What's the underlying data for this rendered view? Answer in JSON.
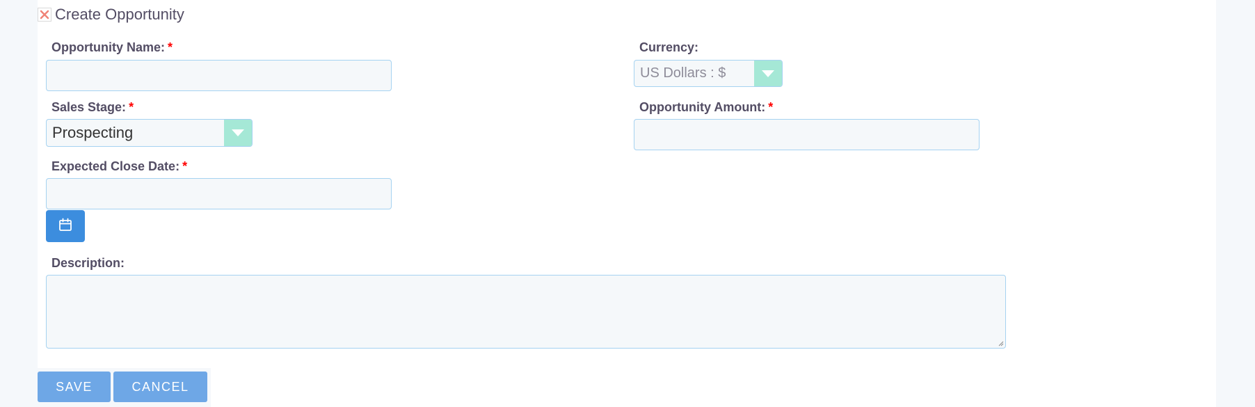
{
  "header": {
    "title": "Create Opportunity"
  },
  "fields": {
    "opportunity_name": {
      "label": "Opportunity Name:",
      "required_mark": "*",
      "value": ""
    },
    "currency": {
      "label": "Currency:",
      "selected": "US Dollars : $"
    },
    "sales_stage": {
      "label": "Sales Stage:",
      "required_mark": "*",
      "selected": "Prospecting"
    },
    "opportunity_amount": {
      "label": "Opportunity Amount:",
      "required_mark": "*",
      "value": ""
    },
    "expected_close_date": {
      "label": "Expected Close Date:",
      "required_mark": "*",
      "value": ""
    },
    "description": {
      "label": "Description:",
      "value": ""
    }
  },
  "buttons": {
    "save": "SAVE",
    "cancel": "CANCEL"
  },
  "colors": {
    "label": "#534d64",
    "required": "#ff0000",
    "input_border": "#a5d2f1",
    "input_bg": "#f5f8fa",
    "select_arrow_bg": "#a5e8d6",
    "calendar_button": "#3c8dde",
    "action_button": "#6ea7e6",
    "close_icon": "#f08377"
  },
  "icons": {
    "close": "close-icon",
    "calendar": "calendar-icon",
    "dropdown": "chevron-down-icon"
  }
}
